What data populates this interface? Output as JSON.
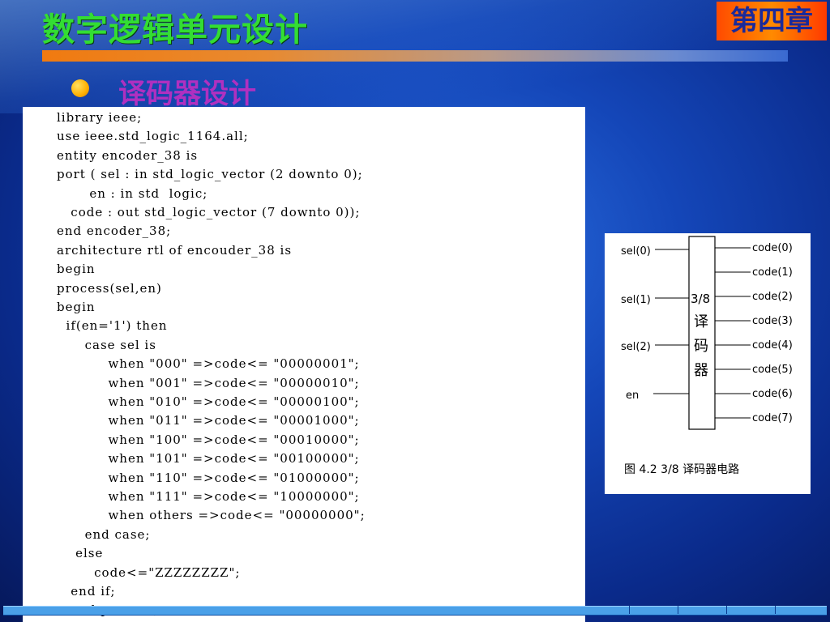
{
  "slide": {
    "title": "数字逻辑单元设计",
    "chapter_badge": "第四章",
    "subtitle": "译码器设计"
  },
  "code_lines": [
    "library ieee;",
    "use ieee.std_logic_1164.all;",
    "entity encoder_38 is",
    "port ( sel : in std_logic_vector (2 downto 0);",
    "       en : in std  logic;",
    "   code : out std_logic_vector (7 downto 0));",
    "end encoder_38;",
    "architecture rtl of encouder_38 is",
    "begin",
    "process(sel,en)",
    "begin",
    "  if(en='1') then",
    "      case sel is",
    "           when \"000\" =>code<= \"00000001\";",
    "           when \"001\" =>code<= \"00000010\";",
    "           when \"010\" =>code<= \"00000100\";",
    "           when \"011\" =>code<= \"00001000\";",
    "           when \"100\" =>code<= \"00010000\";",
    "           when \"101\" =>code<= \"00100000\";",
    "           when \"110\" =>code<= \"01000000\";",
    "           when \"111\" =>code<= \"10000000\";",
    "           when others =>code<= \"00000000\";",
    "      end case;",
    "    else",
    "        code<=\"ZZZZZZZZ\";",
    "   end if;",
    "   end process;"
  ],
  "figure": {
    "inputs": [
      "sel(0)",
      "sel(1)",
      "sel(2)",
      "en"
    ],
    "block_label_top": "3/8",
    "block_label_chars": [
      "译",
      "码",
      "器"
    ],
    "outputs": [
      "code(0)",
      "code(1)",
      "code(2)",
      "code(3)",
      "code(4)",
      "code(5)",
      "code(6)",
      "code(7)"
    ],
    "caption": "图 4.2    3/8 译码器电路"
  }
}
